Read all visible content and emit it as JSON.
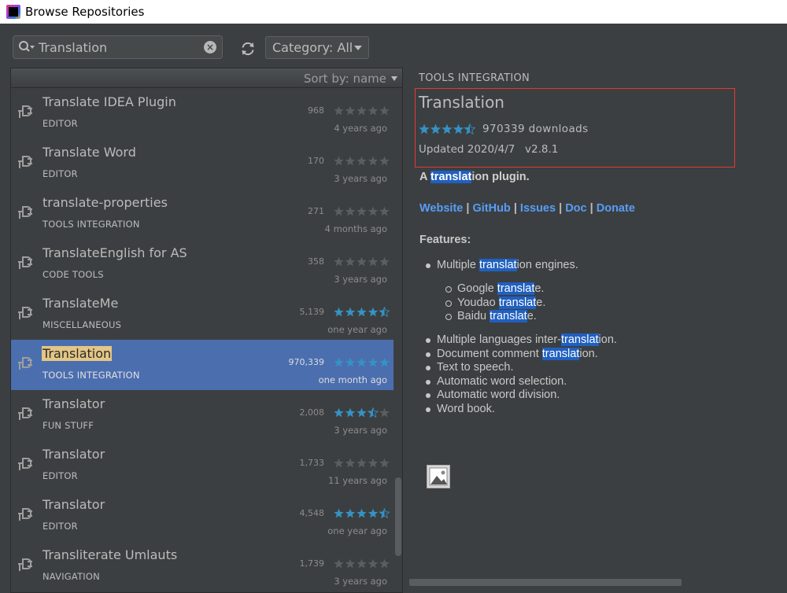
{
  "window": {
    "title": "Browse Repositories"
  },
  "toolbar": {
    "search_value": "Translation",
    "category_label": "Category: All"
  },
  "list": {
    "sort_label": "Sort by: name",
    "plugins": [
      {
        "name": "Translate IDEA Plugin",
        "category": "EDITOR",
        "downloads": "968",
        "date": "4 years ago",
        "rating": 0
      },
      {
        "name": "Translate Word",
        "category": "EDITOR",
        "downloads": "170",
        "date": "3 years ago",
        "rating": 0
      },
      {
        "name": "translate-properties",
        "category": "TOOLS INTEGRATION",
        "downloads": "271",
        "date": "4 months ago",
        "rating": 0
      },
      {
        "name": "TranslateEnglish for AS",
        "category": "CODE TOOLS",
        "downloads": "358",
        "date": "3 years ago",
        "rating": 0
      },
      {
        "name": "TranslateMe",
        "category": "MISCELLANEOUS",
        "downloads": "5,139",
        "date": "one year ago",
        "rating": 4.5
      },
      {
        "name": "Translation",
        "category": "TOOLS INTEGRATION",
        "downloads": "970,339",
        "date": "one month ago",
        "rating": 5
      },
      {
        "name": "Translator",
        "category": "FUN STUFF",
        "downloads": "2,008",
        "date": "3 years ago",
        "rating": 3.5
      },
      {
        "name": "Translator",
        "category": "EDITOR",
        "downloads": "1,733",
        "date": "11 years ago",
        "rating": 0
      },
      {
        "name": "Translator",
        "category": "EDITOR",
        "downloads": "4,548",
        "date": "one year ago",
        "rating": 4.5
      },
      {
        "name": "Transliterate Umlauts",
        "category": "NAVIGATION",
        "downloads": "1,739",
        "date": "3 years ago",
        "rating": 0
      }
    ]
  },
  "detail": {
    "category": "TOOLS INTEGRATION",
    "name": "Translation",
    "rating": 4.5,
    "downloads": "970339 downloads",
    "updated": "Updated 2020/4/7",
    "version": "v2.8.1",
    "desc_prefix": "A ",
    "desc_mark": "translat",
    "desc_suffix": "ion plugin.",
    "links": [
      "Website",
      "GitHub",
      "Issues",
      "Doc",
      "Donate"
    ],
    "link_sep": " | ",
    "features_heading": "Features:",
    "features": [
      {
        "pre": "Multiple ",
        "mark": "translat",
        "post": "ion engines."
      },
      {
        "pre": "Multiple languages inter-",
        "mark": "translat",
        "post": "ion."
      },
      {
        "pre": "Document comment ",
        "mark": "translat",
        "post": "ion."
      },
      {
        "pre": "Text to speech.",
        "mark": "",
        "post": ""
      },
      {
        "pre": "Automatic word selection.",
        "mark": "",
        "post": ""
      },
      {
        "pre": "Automatic word division.",
        "mark": "",
        "post": ""
      },
      {
        "pre": "Word book.",
        "mark": "",
        "post": ""
      }
    ],
    "engines": [
      {
        "pre": "Google ",
        "mark": "translat",
        "post": "e."
      },
      {
        "pre": "Youdao ",
        "mark": "translat",
        "post": "e."
      },
      {
        "pre": "Baidu ",
        "mark": "translat",
        "post": "e."
      }
    ]
  },
  "colors": {
    "selection": "#4b6eaf",
    "star": "#3592c4",
    "link": "#589df6",
    "highlight": "#2060c0"
  },
  "icons": {
    "plugin": "plug-icon",
    "search": "search-icon",
    "refresh": "refresh-icon",
    "clear": "clear-icon"
  }
}
